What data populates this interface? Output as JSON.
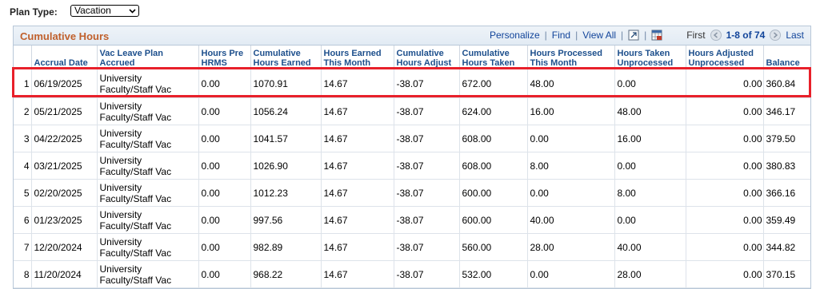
{
  "plan_type": {
    "label": "Plan Type:",
    "selected": "Vacation"
  },
  "grid": {
    "title": "Cumulative Hours",
    "tools": {
      "personalize": "Personalize",
      "find": "Find",
      "view_all": "View All"
    },
    "nav": {
      "first": "First",
      "range": "1-8 of 74",
      "last": "Last"
    },
    "columns": [
      "",
      "Accrual Date",
      "Vac Leave Plan Accrued",
      "Hours Pre HRMS",
      "Cumulative Hours Earned",
      "Hours Earned This Month",
      "Cumulative Hours Adjust",
      "Cumulative Hours Taken",
      "Hours Processed This Month",
      "Hours Taken Unprocessed",
      "Hours Adjusted Unprocessed",
      "Balance"
    ],
    "rows": [
      [
        "1",
        "06/19/2025",
        "University Faculty/Staff Vac",
        "0.00",
        "1070.91",
        "14.67",
        "-38.07",
        "672.00",
        "48.00",
        "0.00",
        "0.00",
        "360.84"
      ],
      [
        "2",
        "05/21/2025",
        "University Faculty/Staff Vac",
        "0.00",
        "1056.24",
        "14.67",
        "-38.07",
        "624.00",
        "16.00",
        "48.00",
        "0.00",
        "346.17"
      ],
      [
        "3",
        "04/22/2025",
        "University Faculty/Staff Vac",
        "0.00",
        "1041.57",
        "14.67",
        "-38.07",
        "608.00",
        "0.00",
        "16.00",
        "0.00",
        "379.50"
      ],
      [
        "4",
        "03/21/2025",
        "University Faculty/Staff Vac",
        "0.00",
        "1026.90",
        "14.67",
        "-38.07",
        "608.00",
        "8.00",
        "0.00",
        "0.00",
        "380.83"
      ],
      [
        "5",
        "02/20/2025",
        "University Faculty/Staff Vac",
        "0.00",
        "1012.23",
        "14.67",
        "-38.07",
        "600.00",
        "0.00",
        "8.00",
        "0.00",
        "366.16"
      ],
      [
        "6",
        "01/23/2025",
        "University Faculty/Staff Vac",
        "0.00",
        "997.56",
        "14.67",
        "-38.07",
        "600.00",
        "40.00",
        "0.00",
        "0.00",
        "359.49"
      ],
      [
        "7",
        "12/20/2024",
        "University Faculty/Staff Vac",
        "0.00",
        "982.89",
        "14.67",
        "-38.07",
        "560.00",
        "28.00",
        "40.00",
        "0.00",
        "344.82"
      ],
      [
        "8",
        "11/20/2024",
        "University Faculty/Staff Vac",
        "0.00",
        "968.22",
        "14.67",
        "-38.07",
        "532.00",
        "0.00",
        "28.00",
        "0.00",
        "370.15"
      ]
    ]
  },
  "colors": {
    "accent_title": "#c0602c",
    "link": "#11449a",
    "highlight": "#e8202a"
  }
}
